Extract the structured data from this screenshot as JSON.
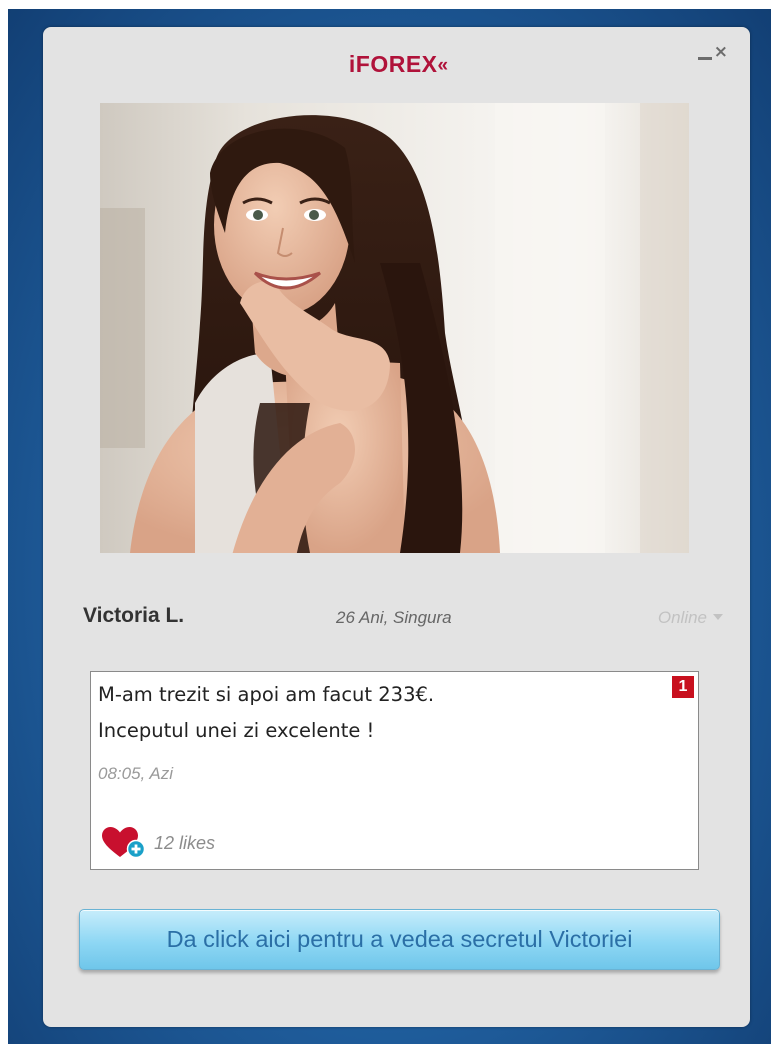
{
  "brand": {
    "name": "iFOREX",
    "chevrons": "«"
  },
  "window": {
    "minimize_symbol": "",
    "close_symbol": "×"
  },
  "profile": {
    "name": "Victoria L.",
    "age_status": "26 Ani, Singura",
    "online_status": "Online"
  },
  "post": {
    "line1": "M-am trezit si apoi am facut 233€.",
    "line2": "Inceputul unei zi excelente !",
    "time": "08:05, Azi",
    "badge_count": "1",
    "likes": "12 likes"
  },
  "cta": {
    "label": "Da click aici pentru a vedea secretul Victoriei"
  },
  "colors": {
    "brand_red": "#b0123a",
    "badge_red": "#c8101e",
    "heart": "#c8102e",
    "plus_badge": "#1aa0c8",
    "cta_text": "#2b6fa6",
    "background_blue": "#1f5d9c"
  },
  "icons": {
    "like": "heart-plus-icon",
    "status_dropdown": "caret-down-icon",
    "minimize": "minimize-icon",
    "close": "close-icon"
  }
}
